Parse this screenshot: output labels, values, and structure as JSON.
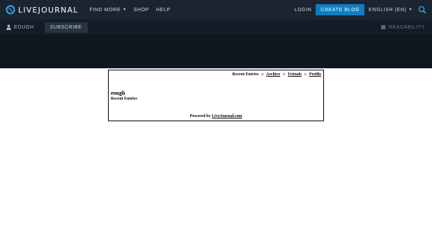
{
  "header": {
    "logo_text": "LIVEJOURNAL",
    "nav": {
      "find_more": "FIND MORE",
      "shop": "SHOP",
      "help": "HELP"
    },
    "login": "LOGIN",
    "create_blog": "CREATE BLOG",
    "language": "ENGLISH (EN)"
  },
  "subbar": {
    "username": "EOUGH",
    "subscribe": "SUBSCRIBE",
    "readability": "READABILITY"
  },
  "journal": {
    "nav": {
      "recent_entries": "Recent Entries",
      "archive": "Archive",
      "friends": "Friends",
      "profile": "Profile",
      "separator": "::"
    },
    "title": "eough",
    "subtitle": "Recent Entries",
    "footer_prefix": "Powered by",
    "footer_link": "LiveJournal.com"
  },
  "colors": {
    "topbar_bg": "#1a2531",
    "subbar_bg": "#141c26",
    "band_bg": "#0f161e",
    "accent": "#0e7ec3",
    "logo_blue": "#3aa2e8"
  },
  "icons": {
    "logo": "livejournal-pencil-icon",
    "search": "search-icon",
    "user": "user-icon",
    "readability": "readability-icon"
  }
}
